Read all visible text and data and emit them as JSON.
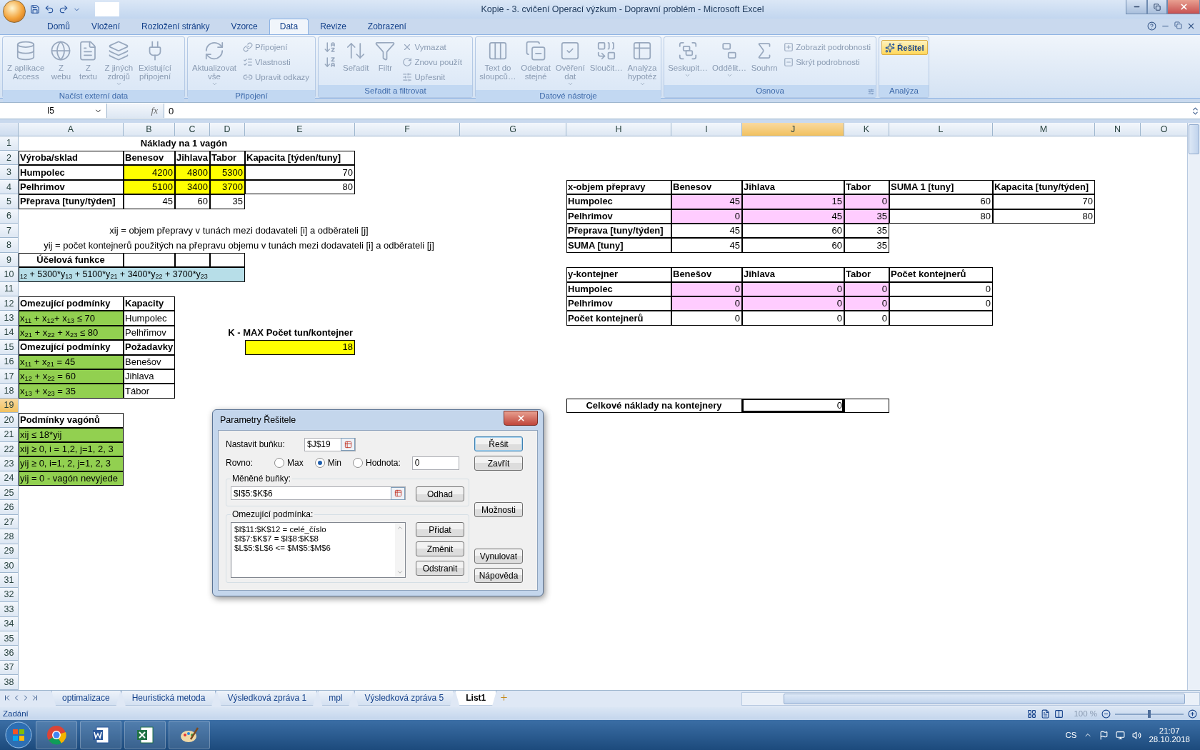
{
  "window": {
    "title": "Kopie - 3. cvičení Operací výzkum - Dopravní problém - Microsoft Excel"
  },
  "ribbon": {
    "tabs": [
      {
        "label": "Domů",
        "selected": false
      },
      {
        "label": "Vložení",
        "selected": false
      },
      {
        "label": "Rozložení stránky",
        "selected": false
      },
      {
        "label": "Vzorce",
        "selected": false
      },
      {
        "label": "Data",
        "selected": true
      },
      {
        "label": "Revize",
        "selected": false
      },
      {
        "label": "Zobrazení",
        "selected": false
      }
    ],
    "groups": [
      {
        "label": "Načíst externí data",
        "items": [
          {
            "kind": "large",
            "label": "Z aplikace\nAccess",
            "disabled": true
          },
          {
            "kind": "large",
            "label": "Z\nwebu",
            "disabled": true
          },
          {
            "kind": "large",
            "label": "Z\ntextu",
            "disabled": true
          },
          {
            "kind": "large",
            "label": "Z jiných\nzdrojů",
            "disabled": true,
            "dropdown": true
          },
          {
            "kind": "large",
            "label": "Existující\npřipojení",
            "disabled": true
          }
        ]
      },
      {
        "label": "Připojení",
        "items": [
          {
            "kind": "large",
            "label": "Aktualizovat\nvše",
            "disabled": true,
            "dropdown": true
          },
          {
            "kind": "small",
            "label": "Připojení",
            "disabled": true
          },
          {
            "kind": "small",
            "label": "Vlastnosti",
            "disabled": true
          },
          {
            "kind": "small",
            "label": "Upravit odkazy",
            "disabled": true
          }
        ]
      },
      {
        "label": "Seřadit a filtrovat",
        "items": [
          {
            "kind": "icon",
            "disabled": true
          },
          {
            "kind": "icon",
            "disabled": true
          },
          {
            "kind": "large",
            "label": "Seřadit",
            "disabled": true
          },
          {
            "kind": "large",
            "label": "Filtr",
            "disabled": true
          },
          {
            "kind": "small",
            "label": "Vymazat",
            "disabled": true
          },
          {
            "kind": "small",
            "label": "Znovu použít",
            "disabled": true
          },
          {
            "kind": "small",
            "label": "Upřesnit",
            "disabled": true
          }
        ]
      },
      {
        "label": "Datové nástroje",
        "items": [
          {
            "kind": "large",
            "label": "Text do\nsloupců…",
            "disabled": true
          },
          {
            "kind": "large",
            "label": "Odebrat\nstejné",
            "disabled": true
          },
          {
            "kind": "large",
            "label": "Ověření\ndat",
            "disabled": true,
            "dropdown": true
          },
          {
            "kind": "large",
            "label": "Sloučit…",
            "disabled": true
          },
          {
            "kind": "large",
            "label": "Analýza\nhypotéz",
            "disabled": true,
            "dropdown": true
          }
        ]
      },
      {
        "label": "Osnova",
        "items": [
          {
            "kind": "large",
            "label": "Seskupit…",
            "disabled": true,
            "dropdown": true
          },
          {
            "kind": "large",
            "label": "Oddělit…",
            "disabled": true,
            "dropdown": true
          },
          {
            "kind": "large",
            "label": "Souhrn",
            "disabled": true
          },
          {
            "kind": "small",
            "label": "Zobrazit podrobnosti",
            "disabled": true
          },
          {
            "kind": "small",
            "label": "Skrýt podrobnosti",
            "disabled": true
          }
        ]
      },
      {
        "label": "Analýza",
        "items": [
          {
            "kind": "small",
            "label": "Řešitel",
            "disabled": false
          }
        ]
      }
    ]
  },
  "formula_bar": {
    "name_box": "I5",
    "function_label": "fx",
    "value": "0"
  },
  "sheet": {
    "columns": [
      {
        "label": "A",
        "selected": false
      },
      {
        "label": "B",
        "selected": false
      },
      {
        "label": "C",
        "selected": false
      },
      {
        "label": "D",
        "selected": false
      },
      {
        "label": "E",
        "selected": false
      },
      {
        "label": "F",
        "selected": false
      },
      {
        "label": "G",
        "selected": false
      },
      {
        "label": "H",
        "selected": false
      },
      {
        "label": "I",
        "selected": false
      },
      {
        "label": "J",
        "selected": true
      },
      {
        "label": "K",
        "selected": false
      },
      {
        "label": "L",
        "selected": false
      },
      {
        "label": "M",
        "selected": false
      },
      {
        "label": "N",
        "selected": false
      },
      {
        "label": "O",
        "selected": false
      }
    ],
    "rows": [
      {
        "number": "1",
        "selected": false,
        "cells": [
          null,
          {
            "kind": "title",
            "text": "Náklady na 1 vagón"
          },
          {
            "kind": "merged"
          },
          {
            "kind": "merged"
          }
        ]
      },
      {
        "number": "2",
        "selected": false,
        "cells": [
          {
            "kind": "heading",
            "text": "Výroba/sklad",
            "boxed": true
          },
          {
            "kind": "heading",
            "text": "Benesov",
            "boxed": true
          },
          {
            "kind": "heading",
            "text": "Jihlava",
            "boxed": true
          },
          {
            "kind": "heading",
            "text": "Tabor",
            "boxed": true
          },
          {
            "kind": "heading",
            "text": "Kapacita [týden/tuny]",
            "boxed": true
          }
        ]
      },
      {
        "number": "3",
        "selected": false,
        "cells": [
          {
            "kind": "heading",
            "text": "Humpolec",
            "boxed": true
          },
          {
            "kind": "number",
            "text": "4200",
            "color": "#ffff00",
            "boxed": true
          },
          {
            "kind": "number",
            "text": "4800",
            "color": "#ffff00",
            "boxed": true
          },
          {
            "kind": "number",
            "text": "5300",
            "color": "#ffff00",
            "boxed": true
          },
          {
            "kind": "number",
            "text": "70",
            "boxed": true
          }
        ]
      },
      {
        "number": "4",
        "selected": false,
        "cells": [
          {
            "kind": "heading",
            "text": "Pelhrimov",
            "boxed": true
          },
          {
            "kind": "number",
            "text": "5100",
            "color": "#ffff00",
            "boxed": true
          },
          {
            "kind": "number",
            "text": "3400",
            "color": "#ffff00",
            "boxed": true
          },
          {
            "kind": "number",
            "text": "3700",
            "color": "#ffff00",
            "boxed": true
          },
          {
            "kind": "number",
            "text": "80",
            "boxed": true
          },
          null,
          null,
          {
            "kind": "heading",
            "text": "x-objem přepravy",
            "boxed": true
          },
          {
            "kind": "heading",
            "text": "Benesov",
            "boxed": true
          },
          {
            "kind": "heading",
            "text": "Jihlava",
            "boxed": true
          },
          {
            "kind": "heading",
            "text": "Tabor",
            "boxed": true
          },
          {
            "kind": "heading",
            "text": "SUMA 1 [tuny]",
            "boxed": true
          },
          {
            "kind": "heading",
            "text": "Kapacita [tuny/týden]",
            "boxed": true
          }
        ]
      },
      {
        "number": "5",
        "selected": false,
        "cells": [
          {
            "kind": "heading",
            "text": "Přeprava [tuny/týden]",
            "boxed": true
          },
          {
            "kind": "number",
            "text": "45",
            "boxed": true
          },
          {
            "kind": "number",
            "text": "60",
            "boxed": true
          },
          {
            "kind": "number",
            "text": "35",
            "boxed": true
          },
          null,
          null,
          null,
          {
            "kind": "heading",
            "text": "Humpolec",
            "boxed": true
          },
          {
            "kind": "number",
            "text": "45",
            "color": "#ffccff",
            "boxed": true
          },
          {
            "kind": "number",
            "text": "15",
            "color": "#ffccff",
            "boxed": true
          },
          {
            "kind": "number",
            "text": "0",
            "color": "#ffccff",
            "boxed": true
          },
          {
            "kind": "number",
            "text": "60",
            "boxed": true
          },
          {
            "kind": "number",
            "text": "70",
            "boxed": true
          }
        ]
      },
      {
        "number": "6",
        "selected": false,
        "cells": [
          null,
          null,
          null,
          null,
          null,
          null,
          null,
          {
            "kind": "heading",
            "text": "Pelhrimov",
            "boxed": true
          },
          {
            "kind": "number",
            "text": "0",
            "color": "#ffccff",
            "boxed": true
          },
          {
            "kind": "number",
            "text": "45",
            "color": "#ffccff",
            "boxed": true
          },
          {
            "kind": "number",
            "text": "35",
            "color": "#ffccff",
            "boxed": true
          },
          {
            "kind": "number",
            "text": "80",
            "boxed": true
          },
          {
            "kind": "number",
            "text": "80",
            "boxed": true
          }
        ]
      },
      {
        "number": "7",
        "selected": false,
        "cells": [
          {
            "kind": "note",
            "text": "xij = objem přepravy v tunách mezi dodavateli [i] a odběrateli [j]"
          },
          {
            "kind": "merged"
          },
          {
            "kind": "merged"
          },
          {
            "kind": "merged"
          },
          {
            "kind": "merged"
          },
          {
            "kind": "merged"
          },
          null,
          {
            "kind": "heading",
            "text": "Přeprava [tuny/týden]",
            "boxed": true
          },
          {
            "kind": "number",
            "text": "45",
            "boxed": true
          },
          {
            "kind": "number",
            "text": "60",
            "boxed": true
          },
          {
            "kind": "number",
            "text": "35",
            "boxed": true
          }
        ]
      },
      {
        "number": "8",
        "selected": false,
        "cells": [
          {
            "kind": "note",
            "text": "yij = počet kontejnerů použitých na přepravu objemu v tunách mezi dodavateli [i] a odběrateli [j]"
          },
          {
            "kind": "merged"
          },
          {
            "kind": "merged"
          },
          {
            "kind": "merged"
          },
          {
            "kind": "merged"
          },
          {
            "kind": "merged"
          },
          null,
          {
            "kind": "heading",
            "text": "SUMA [tuny]",
            "boxed": true
          },
          {
            "kind": "number",
            "text": "45",
            "boxed": true
          },
          {
            "kind": "number",
            "text": "60",
            "boxed": true
          },
          {
            "kind": "number",
            "text": "35",
            "boxed": true
          }
        ]
      },
      {
        "number": "9",
        "selected": false,
        "cells": [
          {
            "kind": "title",
            "text": "Účelová funkce",
            "boxed": true
          },
          {
            "kind": "label",
            "boxed": true
          },
          {
            "kind": "label",
            "boxed": true
          },
          {
            "kind": "label",
            "boxed": true
          }
        ]
      },
      {
        "number": "10",
        "selected": false,
        "cells": [
          {
            "kind": "formula",
            "text": "$_{12}$ + 5300*y$_{13}$ + 5100*y$_{21}$ + 3400*y$_{22}$ + 3700*y$_{23}$",
            "color": "#b7dee8",
            "boxed": true
          },
          {
            "kind": "merged"
          },
          {
            "kind": "merged"
          },
          {
            "kind": "merged"
          },
          null,
          null,
          null,
          {
            "kind": "heading",
            "text": "y-kontejner",
            "boxed": true
          },
          {
            "kind": "heading",
            "text": "Benešov",
            "boxed": true
          },
          {
            "kind": "heading",
            "text": "Jihlava",
            "boxed": true
          },
          {
            "kind": "heading",
            "text": "Tabor",
            "boxed": true
          },
          {
            "kind": "heading",
            "text": "Počet kontejnerů",
            "boxed": true
          }
        ]
      },
      {
        "number": "11",
        "selected": false,
        "cells": [
          null,
          null,
          null,
          null,
          null,
          null,
          null,
          {
            "kind": "heading",
            "text": "Humpolec",
            "boxed": true
          },
          {
            "kind": "number",
            "text": "0",
            "color": "#ffccff",
            "boxed": true
          },
          {
            "kind": "number",
            "text": "0",
            "color": "#ffccff",
            "boxed": true
          },
          {
            "kind": "number",
            "text": "0",
            "color": "#ffccff",
            "boxed": true
          },
          {
            "kind": "number",
            "text": "0",
            "boxed": true
          }
        ]
      },
      {
        "number": "12",
        "selected": false,
        "cells": [
          {
            "kind": "heading",
            "text": "Omezující podmínky",
            "boxed": true
          },
          {
            "kind": "heading",
            "text": "Kapacity",
            "boxed": true
          },
          null,
          null,
          null,
          null,
          null,
          {
            "kind": "heading",
            "text": "Pelhrimov",
            "boxed": true
          },
          {
            "kind": "number",
            "text": "0",
            "color": "#ffccff",
            "boxed": true
          },
          {
            "kind": "number",
            "text": "0",
            "color": "#ffccff",
            "boxed": true
          },
          {
            "kind": "number",
            "text": "0",
            "color": "#ffccff",
            "boxed": true
          },
          {
            "kind": "number",
            "text": "0",
            "boxed": true
          }
        ]
      },
      {
        "number": "13",
        "selected": false,
        "cells": [
          {
            "kind": "label",
            "text": "x$_{11}$ + x$_{12}$+ x$_{13}$ ≤ 70",
            "color": "#92d050",
            "boxed": true
          },
          {
            "kind": "label",
            "text": "Humpolec",
            "boxed": true
          },
          null,
          null,
          null,
          null,
          null,
          {
            "kind": "heading",
            "text": "Počet kontejnerů",
            "boxed": true
          },
          {
            "kind": "number",
            "text": "0",
            "boxed": true
          },
          {
            "kind": "number",
            "text": "0",
            "boxed": true
          },
          {
            "kind": "number",
            "text": "0",
            "boxed": true
          },
          {
            "kind": "label",
            "boxed": true
          }
        ]
      },
      {
        "number": "14",
        "selected": false,
        "cells": [
          {
            "kind": "label",
            "text": "x$_{21}$ + x$_{22}$ + x$_{23}$ ≤ 80",
            "color": "#92d050",
            "boxed": true
          },
          {
            "kind": "label",
            "text": "Pelhřimov",
            "boxed": true
          },
          null,
          {
            "kind": "caption",
            "text": "K - MAX Počet tun/kontejner"
          },
          {
            "kind": "merged"
          }
        ]
      },
      {
        "number": "15",
        "selected": false,
        "cells": [
          {
            "kind": "heading",
            "text": "Omezující podmínky",
            "boxed": true
          },
          {
            "kind": "heading",
            "text": "Požadavky",
            "boxed": true
          },
          null,
          null,
          {
            "kind": "number",
            "text": "18",
            "color": "#ffff00",
            "boxed": true
          }
        ]
      },
      {
        "number": "16",
        "selected": false,
        "cells": [
          {
            "kind": "label",
            "text": "x$_{11}$ + x$_{21}$ = 45",
            "color": "#92d050",
            "boxed": true
          },
          {
            "kind": "label",
            "text": "Benešov",
            "boxed": true
          }
        ]
      },
      {
        "number": "17",
        "selected": false,
        "cells": [
          {
            "kind": "label",
            "text": "x$_{12}$ + x$_{22}$ = 60",
            "color": "#92d050",
            "boxed": true
          },
          {
            "kind": "label",
            "text": "Jihlava",
            "boxed": true
          }
        ]
      },
      {
        "number": "18",
        "selected": false,
        "cells": [
          {
            "kind": "label",
            "text": "x$_{13}$ + x$_{23}$ = 35",
            "color": "#92d050",
            "boxed": true
          },
          {
            "kind": "label",
            "text": "Tábor",
            "boxed": true
          }
        ]
      },
      {
        "number": "19",
        "selected": true,
        "cells": [
          null,
          null,
          null,
          null,
          null,
          null,
          null,
          {
            "kind": "title",
            "text": "Celkové náklady na kontejnery",
            "boxed": true
          },
          {
            "kind": "merged"
          },
          {
            "kind": "number",
            "text": "0",
            "boxed": true
          },
          {
            "kind": "label",
            "boxed": true
          }
        ]
      },
      {
        "number": "20",
        "selected": false,
        "cells": [
          {
            "kind": "heading",
            "text": "Podmínky vagónů",
            "boxed": true
          }
        ]
      },
      {
        "number": "21",
        "selected": false,
        "cells": [
          {
            "kind": "label",
            "text": "xij ≤ 18*yij",
            "color": "#92d050",
            "boxed": true
          }
        ]
      },
      {
        "number": "22",
        "selected": false,
        "cells": [
          {
            "kind": "label",
            "text": "xij ≥ 0, i = 1,2, j=1, 2, 3",
            "color": "#92d050",
            "boxed": true
          }
        ]
      },
      {
        "number": "23",
        "selected": false,
        "cells": [
          {
            "kind": "label",
            "text": "yij ≥ 0, i=1, 2, j=1, 2, 3",
            "color": "#92d050",
            "boxed": true
          }
        ]
      },
      {
        "number": "24",
        "selected": false,
        "cells": [
          {
            "kind": "label",
            "text": "yij = 0 - vagón nevyjede",
            "color": "#92d050",
            "boxed": true
          }
        ]
      },
      {
        "number": "25",
        "selected": false
      },
      {
        "number": "26",
        "selected": false
      },
      {
        "number": "27",
        "selected": false
      },
      {
        "number": "28",
        "selected": false
      },
      {
        "number": "29",
        "selected": false
      },
      {
        "number": "30",
        "selected": false
      },
      {
        "number": "31",
        "selected": false
      },
      {
        "number": "32",
        "selected": false
      },
      {
        "number": "33",
        "selected": false
      },
      {
        "number": "34",
        "selected": false
      },
      {
        "number": "35",
        "selected": false
      },
      {
        "number": "36",
        "selected": false
      },
      {
        "number": "37",
        "selected": false
      },
      {
        "number": "38",
        "selected": false
      }
    ]
  },
  "sheet_tabs": [
    {
      "label": "optimalizace",
      "selected": false
    },
    {
      "label": "Heuristická metoda",
      "selected": false
    },
    {
      "label": "Výsledková zpráva 1",
      "selected": false
    },
    {
      "label": "mpl",
      "selected": false
    },
    {
      "label": "Výsledková zpráva 5",
      "selected": false
    },
    {
      "label": "List1",
      "selected": true
    }
  ],
  "status_bar": {
    "mode": "Zadání",
    "zoom": "100 %",
    "zoom_slider": {
      "level": 0.5
    }
  },
  "dialog": {
    "title": "Parametry Řešitele",
    "target_label": "Nastavit buňku:",
    "target_value": "$J$19",
    "equal_label": "Rovno:",
    "options": [
      {
        "label": "Max",
        "selected": false
      },
      {
        "label": "Min",
        "selected": true
      },
      {
        "label": "Hodnota:",
        "selected": false
      }
    ],
    "value_field": "0",
    "changing_label": "Měněné buňky:",
    "changing_value": "$I$5:$K$6",
    "guess_button": "Odhad",
    "constraints_label": "Omezující podmínka:",
    "constraints": [
      "$I$11:$K$12 = celé_číslo",
      "$I$7:$K$7 = $I$8:$K$8",
      "$L$5:$L$6 <= $M$5:$M$6"
    ],
    "constraint_buttons": [
      "Přidat",
      "Změnit",
      "Odstranit"
    ],
    "side_buttons": [
      [
        "Řešit",
        "Zavřít"
      ],
      [
        "Možnosti"
      ],
      [
        "Vynulovat",
        "Nápověda"
      ]
    ]
  },
  "taskbar": {
    "language": "CS",
    "time": "21:07",
    "date": "28.10.2018"
  }
}
